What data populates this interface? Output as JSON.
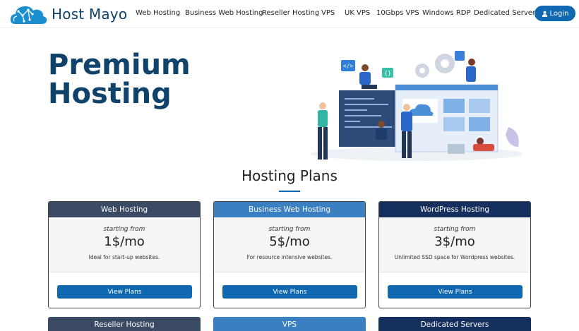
{
  "brand": {
    "name": "Host Mayo"
  },
  "nav": {
    "items": [
      {
        "label": "Web Hosting"
      },
      {
        "label": "Business Web Hosting"
      },
      {
        "label": "Reseller Hosting"
      },
      {
        "label": "VPS"
      },
      {
        "label": "UK VPS"
      },
      {
        "label": "10Gbps VPS"
      },
      {
        "label": "Windows RDP"
      },
      {
        "label": "Dedicated Servers"
      }
    ],
    "login_label": "Login"
  },
  "hero": {
    "title_line1": "Premium",
    "title_line2": "Hosting"
  },
  "plans": {
    "section_title": "Hosting Plans",
    "cards": [
      {
        "name": "Web Hosting",
        "starting": "starting from",
        "price": "1$/mo",
        "description": "Ideal for start-up websites.",
        "button": "View Plans",
        "header_color": "#3b4a63"
      },
      {
        "name": "Business Web Hosting",
        "starting": "starting from",
        "price": "5$/mo",
        "description": "For resource intensive websites.",
        "button": "View Plans",
        "header_color": "#3a7fc0"
      },
      {
        "name": "WordPress Hosting",
        "starting": "starting from",
        "price": "3$/mo",
        "description": "Unlimited SSD space for Wordpress websites.",
        "button": "View Plans",
        "header_color": "#15305e"
      }
    ],
    "next_row": [
      {
        "name": "Reseller Hosting",
        "header_color": "#3b4a63"
      },
      {
        "name": "VPS",
        "header_color": "#3a7fc0"
      },
      {
        "name": "Dedicated Servers",
        "header_color": "#15305e"
      }
    ]
  },
  "colors": {
    "accent": "#0f68b0",
    "brand": "#10436b"
  }
}
